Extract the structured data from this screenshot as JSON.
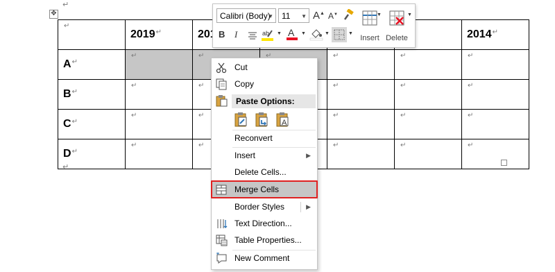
{
  "table": {
    "year_headers": [
      "2019",
      "2018",
      "",
      "",
      "",
      "2014"
    ],
    "row_labels": [
      "A",
      "B",
      "C",
      "D"
    ],
    "cell_mark": "↵",
    "selected_row": "A",
    "selected_columns": [
      "2019",
      "2018",
      ""
    ]
  },
  "mini_toolbar": {
    "font_name": "Calibri (Body)",
    "font_size": "11",
    "grow_font_label": "A",
    "shrink_font_label": "A",
    "bold_label": "B",
    "italic_label": "I",
    "font_color_label": "A",
    "insert_label": "Insert",
    "delete_label": "Delete",
    "icons": [
      "grow-font-icon",
      "shrink-font-icon",
      "format-painter-icon",
      "align-center-icon",
      "highlight-icon",
      "shading-icon",
      "borders-icon",
      "insert-table-icon",
      "delete-table-icon"
    ],
    "colors": {
      "highlight": "#ffe600",
      "font": "#e81123",
      "accent_blue": "#2e75b6"
    }
  },
  "context_menu": {
    "cut": "Cut",
    "copy": "Copy",
    "paste_options": "Paste Options:",
    "reconvert": "Reconvert",
    "insert": "Insert",
    "delete_cells": "Delete Cells...",
    "merge_cells": "Merge Cells",
    "border_styles": "Border Styles",
    "text_direction": "Text Direction...",
    "table_properties": "Table Properties...",
    "new_comment": "New Comment",
    "highlighted_item": "Merge Cells",
    "highlight_border_color": "#e02020"
  }
}
